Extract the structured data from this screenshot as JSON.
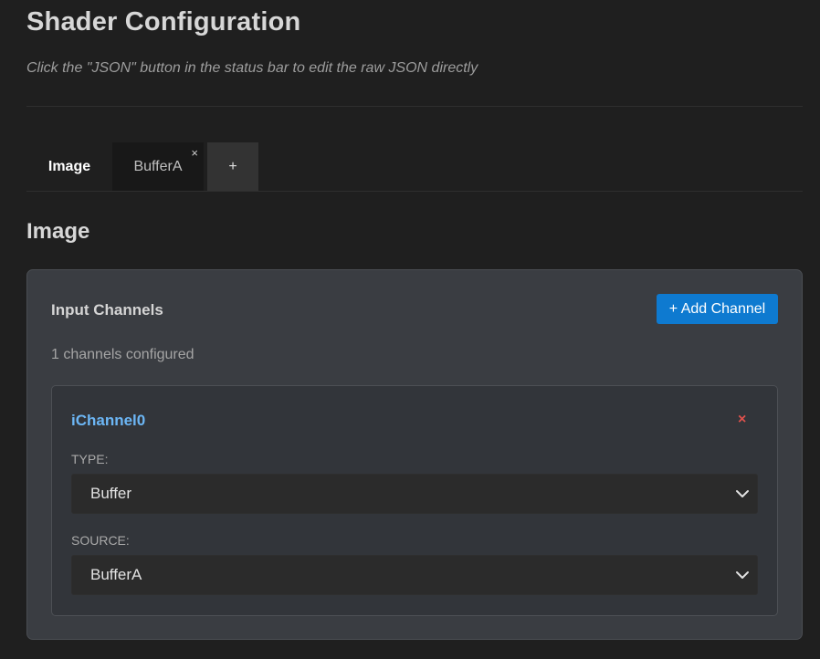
{
  "header": {
    "title": "Shader Configuration",
    "subtitle": "Click the \"JSON\" button in the status bar to edit the raw JSON directly"
  },
  "tabs": [
    {
      "label": "Image",
      "active": true
    },
    {
      "label": "BufferA",
      "active": false,
      "close": "×"
    },
    {
      "label": "+"
    }
  ],
  "section": {
    "title": "Image"
  },
  "panel": {
    "heading": "Input Channels",
    "add_button": "+ Add Channel",
    "count_text": "1 channels configured"
  },
  "channel": {
    "name": "iChannel0",
    "remove": "×",
    "type_label": "TYPE:",
    "type_value": "Buffer",
    "source_label": "SOURCE:",
    "source_value": "BufferA"
  },
  "colors": {
    "accent": "#0e7ad0",
    "channel_name": "#6cb6f5",
    "remove": "#e0524d"
  },
  "icons": {
    "dropdown": "chevron-down-icon",
    "close": "close-icon"
  }
}
